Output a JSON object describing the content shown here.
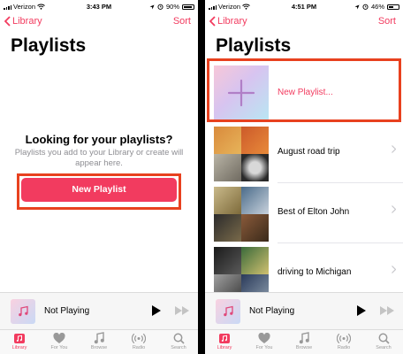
{
  "left": {
    "status": {
      "carrier": "Verizon",
      "time": "3:43 PM",
      "battery": "90%",
      "battery_level": 0.9
    },
    "nav": {
      "back_label": "Library",
      "sort_label": "Sort"
    },
    "title": "Playlists",
    "empty_state": {
      "heading": "Looking for your playlists?",
      "body": "Playlists you add to your Library or create will appear here."
    },
    "new_playlist_button": "New Playlist",
    "mini_player": {
      "title": "Not Playing"
    },
    "tabs": [
      {
        "label": "Library",
        "icon": "library-icon",
        "active": true
      },
      {
        "label": "For You",
        "icon": "heart-icon",
        "active": false
      },
      {
        "label": "Browse",
        "icon": "music-note-icon",
        "active": false
      },
      {
        "label": "Radio",
        "icon": "radio-icon",
        "active": false
      },
      {
        "label": "Search",
        "icon": "search-icon",
        "active": false
      }
    ]
  },
  "right": {
    "status": {
      "carrier": "Verizon",
      "time": "4:51 PM",
      "battery": "46%",
      "battery_level": 0.46
    },
    "nav": {
      "back_label": "Library",
      "sort_label": "Sort"
    },
    "title": "Playlists",
    "new_playlist_row": "New Playlist...",
    "playlists": [
      {
        "name": "August road trip"
      },
      {
        "name": "Best of Elton John"
      },
      {
        "name": "driving to Michigan"
      }
    ],
    "mini_player": {
      "title": "Not Playing"
    },
    "tabs": [
      {
        "label": "Library",
        "icon": "library-icon",
        "active": true
      },
      {
        "label": "For You",
        "icon": "heart-icon",
        "active": false
      },
      {
        "label": "Browse",
        "icon": "music-note-icon",
        "active": false
      },
      {
        "label": "Radio",
        "icon": "radio-icon",
        "active": false
      },
      {
        "label": "Search",
        "icon": "search-icon",
        "active": false
      }
    ]
  },
  "colors": {
    "accent": "#f23b5f",
    "highlight_box": "#e8411f",
    "divider": "#000000"
  }
}
